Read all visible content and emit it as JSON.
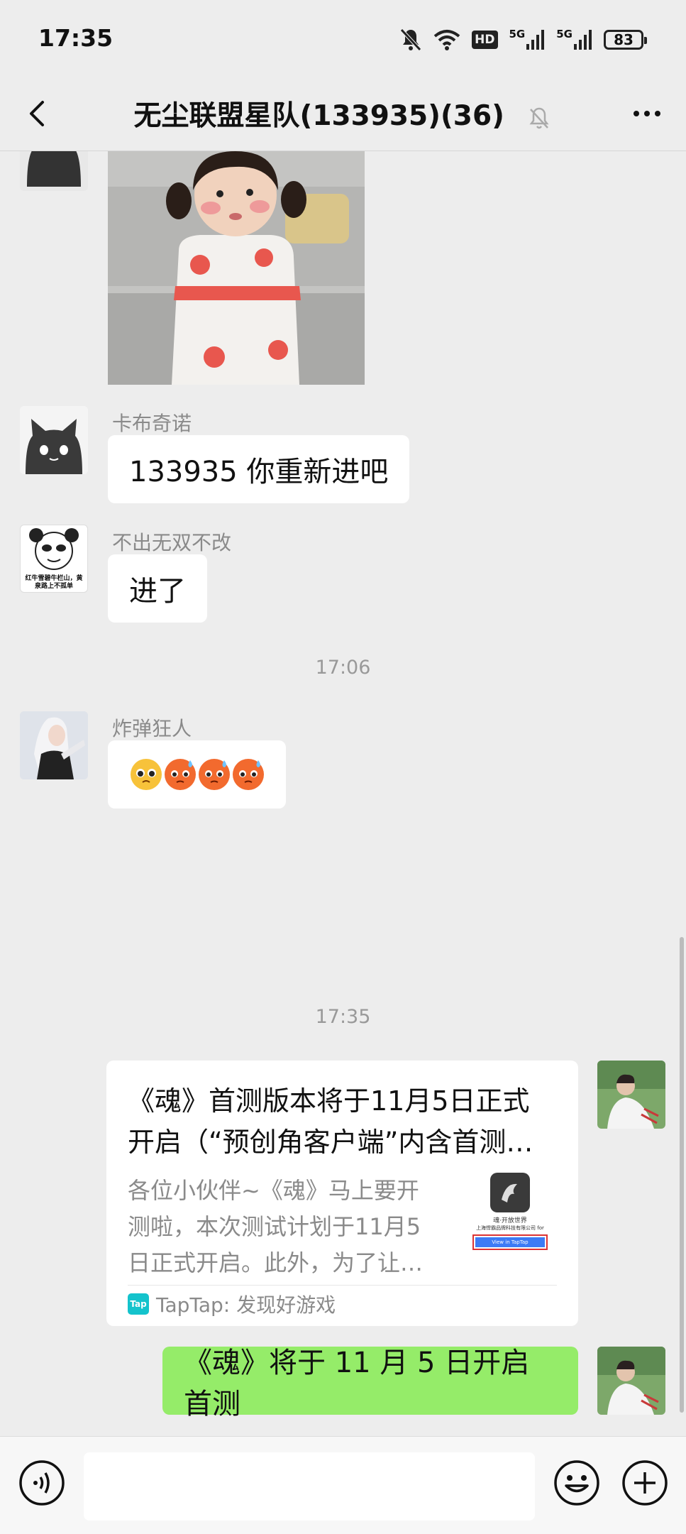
{
  "status_bar": {
    "time": "17:35",
    "battery": "83",
    "icons": [
      "mute-bell-icon",
      "wifi-icon",
      "hd-icon",
      "5g-signal-icon",
      "5g-signal-icon",
      "battery-icon"
    ],
    "hd_label": "HD",
    "net_label": "5G"
  },
  "header": {
    "title": "无尘联盟星队(133935)(36)",
    "back_icon": "chevron-left-icon",
    "mute_icon": "muted-bell-icon",
    "more_icon": "more-dots-icon"
  },
  "messages": [
    {
      "type": "image",
      "from": "other",
      "description": "sticker"
    },
    {
      "type": "text",
      "from": "other",
      "sender": "卡布奇诺",
      "text": "133935 你重新进吧"
    },
    {
      "type": "text",
      "from": "other",
      "sender": "不出无双不改",
      "text": "进了",
      "avatar_caption": "红牛雪碧牛栏山，黄泉路上不孤单"
    },
    {
      "type": "time",
      "text": "17:06"
    },
    {
      "type": "emoji",
      "from": "other",
      "sender": "炸弹狂人",
      "emojis": [
        "pleading-face",
        "sweat-face",
        "sweat-face",
        "sweat-face"
      ]
    },
    {
      "type": "time",
      "text": "17:35"
    },
    {
      "type": "link",
      "from": "me",
      "title": "《魂》首测版本将于11月5日正式开启（“预创角客户端”内含首测…",
      "title_lines": [
        "《魂》首测版本将于11月5日正式",
        "开启（“预创角客户端”内含首测…"
      ],
      "desc_lines": [
        "各位小伙伴~《魂》马上要开",
        "测啦，本次测试计划于11月5",
        "日正式开启。此外，为了让…"
      ],
      "thumb_caption": "魂·开放世界",
      "thumb_company": "上海悍霸品牌科技有限公司 for",
      "thumb_button": "View in TapTap",
      "source": "TapTap: 发现好游戏",
      "source_icon_text": "Tap"
    },
    {
      "type": "text",
      "from": "me",
      "text": "《魂》将于 11 月 5 日开启首测"
    }
  ],
  "input_bar": {
    "voice_icon": "voice-icon",
    "placeholder": "",
    "emoji_icon": "emoji-icon",
    "plus_icon": "plus-icon"
  },
  "colors": {
    "background": "#ededed",
    "my_bubble": "#95ec69",
    "other_bubble": "#ffffff",
    "taptap": "#14c3cc"
  }
}
